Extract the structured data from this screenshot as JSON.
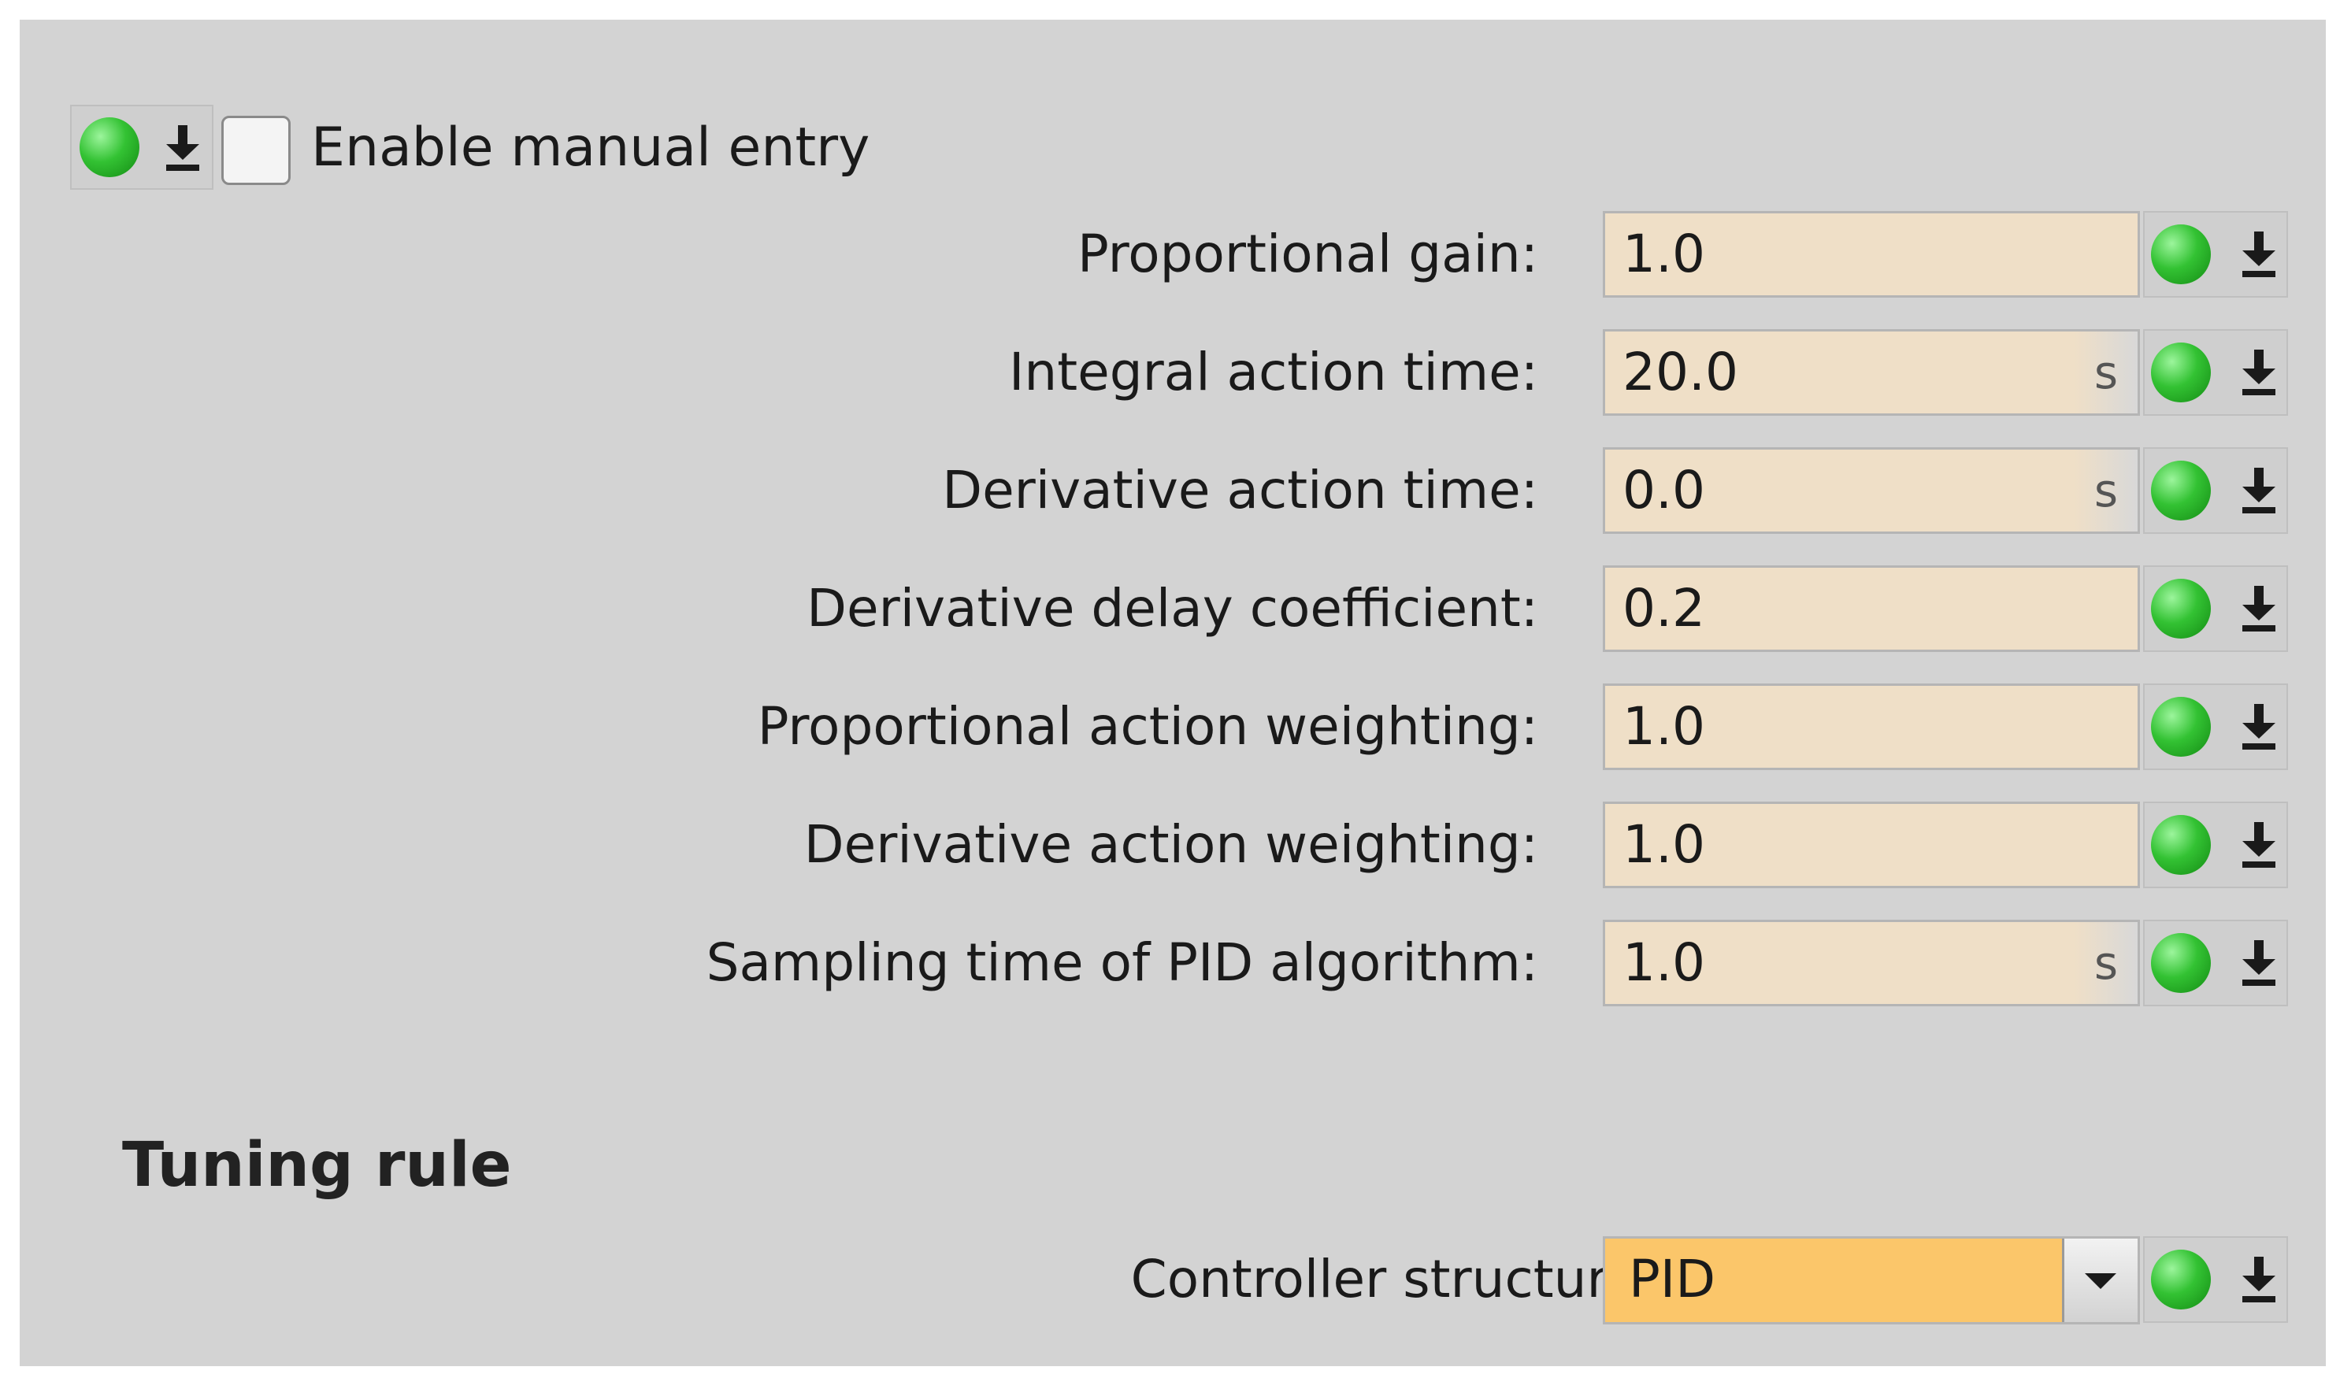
{
  "header": {
    "status_icon": "green-led-icon",
    "download_icon": "download-arrow-icon",
    "manual_entry_checked": false,
    "manual_entry_label": "Enable manual entry"
  },
  "parameters": [
    {
      "label": "Proportional gain:",
      "value": "1.0",
      "unit": ""
    },
    {
      "label": "Integral action time:",
      "value": "20.0",
      "unit": "s"
    },
    {
      "label": "Derivative action time:",
      "value": "0.0",
      "unit": "s"
    },
    {
      "label": "Derivative delay coefficient:",
      "value": "0.2",
      "unit": ""
    },
    {
      "label": "Proportional action weighting:",
      "value": "1.0",
      "unit": ""
    },
    {
      "label": "Derivative action weighting:",
      "value": "1.0",
      "unit": ""
    },
    {
      "label": "Sampling time of PID algorithm:",
      "value": "1.0",
      "unit": "s"
    }
  ],
  "tuning": {
    "title": "Tuning rule",
    "controller_structure_label": "Controller structure:",
    "controller_structure_value": "PID"
  },
  "colors": {
    "panel": "#d3d3d3",
    "field": "#efdfc7",
    "select_highlight": "#fbc66a",
    "status_ok": "#33c233"
  }
}
